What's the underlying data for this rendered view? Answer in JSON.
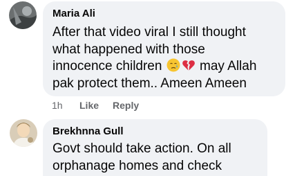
{
  "comments": [
    {
      "author": "Maria Ali",
      "lines": [
        "After that video viral I still thought",
        "what happened with those",
        "innocence children",
        "may Allah",
        "pak protect them.. Ameen Ameen"
      ],
      "emojis": [
        "crying-face-emoji",
        "broken-heart-emoji"
      ],
      "timestamp": "1h",
      "like_label": "Like",
      "reply_label": "Reply"
    },
    {
      "author": "Brekhnna Gull",
      "lines": [
        "Govt should take action. On all",
        "orphanage homes and check"
      ]
    }
  ],
  "colors": {
    "bubble": "#f0f2f5",
    "text": "#050505",
    "meta": "#65676b"
  }
}
